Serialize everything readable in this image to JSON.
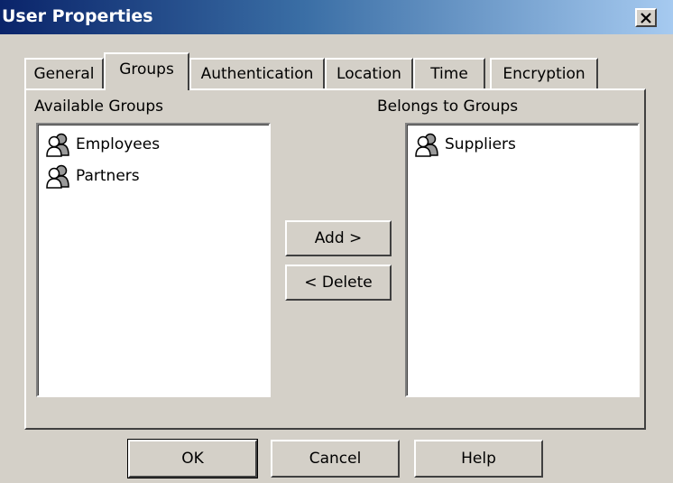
{
  "window": {
    "title": "User Properties"
  },
  "tabs": [
    {
      "label": "General"
    },
    {
      "label": "Groups",
      "active": true
    },
    {
      "label": "Authentication"
    },
    {
      "label": "Location"
    },
    {
      "label": "Time"
    },
    {
      "label": "Encryption"
    }
  ],
  "available": {
    "label": "Available Groups",
    "items": [
      {
        "label": "Employees"
      },
      {
        "label": "Partners"
      }
    ]
  },
  "belongs": {
    "label": "Belongs to Groups",
    "items": [
      {
        "label": "Suppliers"
      }
    ]
  },
  "actions": {
    "add_label": "Add >",
    "delete_label": "< Delete"
  },
  "footer": {
    "ok_label": "OK",
    "cancel_label": "Cancel",
    "help_label": "Help"
  },
  "icons": {
    "close": "close-icon",
    "group": "group-icon"
  },
  "colors": {
    "titlebar_start": "#0a246a",
    "titlebar_end": "#a6caf0",
    "face": "#d4d0c8"
  }
}
